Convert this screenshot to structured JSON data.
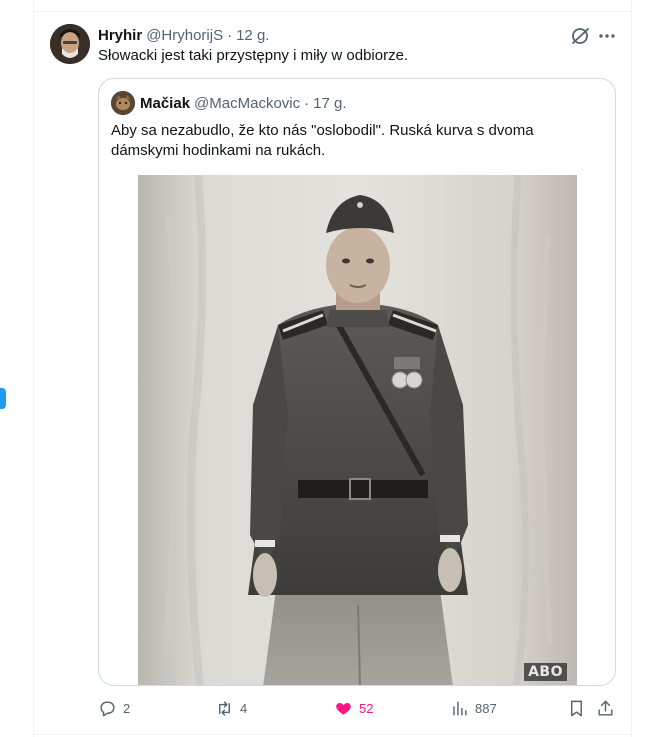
{
  "tweet": {
    "author_name": "Hryhir",
    "author_handle": "@HryhorijS",
    "time": "12 g.",
    "text": "Słowacki jest taki przystępny i miły w odbiorze."
  },
  "quoted": {
    "author_name": "Mačiak",
    "author_handle": "@MacMackovic",
    "time": "17 g.",
    "text": "Aby sa nezabudlo, že kto nás \"oslobodil\". Ruská kurva s dvoma dámskymi hodinkami na rukách.",
    "image_watermark": "ABO"
  },
  "actions": {
    "replies": "2",
    "retweets": "4",
    "likes": "52",
    "views": "887"
  },
  "colors": {
    "accent": "#1d9bf0",
    "like": "#f91880",
    "muted": "#536471",
    "border": "#cfd9de"
  },
  "icons": [
    "grok-icon",
    "more-icon",
    "reply-icon",
    "retweet-icon",
    "like-icon",
    "views-icon",
    "bookmark-icon",
    "share-icon"
  ]
}
